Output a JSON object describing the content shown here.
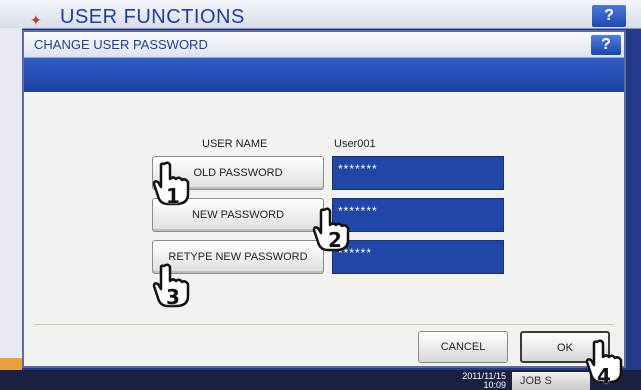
{
  "background": {
    "title": "USER FUNCTIONS",
    "help_label": "?",
    "clock_date": "2011/11/15",
    "clock_time": "10:09",
    "job_status_label": "JOB S"
  },
  "dialog": {
    "title": "CHANGE USER PASSWORD",
    "help_label": "?",
    "user_name_label": "USER NAME",
    "user_name_value": "User001",
    "old_password_label": "OLD PASSWORD",
    "old_password_value": "*******",
    "new_password_label": "NEW PASSWORD",
    "new_password_value": "*******",
    "retype_password_label": "RETYPE NEW PASSWORD",
    "retype_password_value": "******",
    "cancel_label": "CANCEL",
    "ok_label": "OK"
  },
  "callouts": {
    "step1": "1",
    "step2": "2",
    "step3": "3",
    "step4": "4"
  }
}
